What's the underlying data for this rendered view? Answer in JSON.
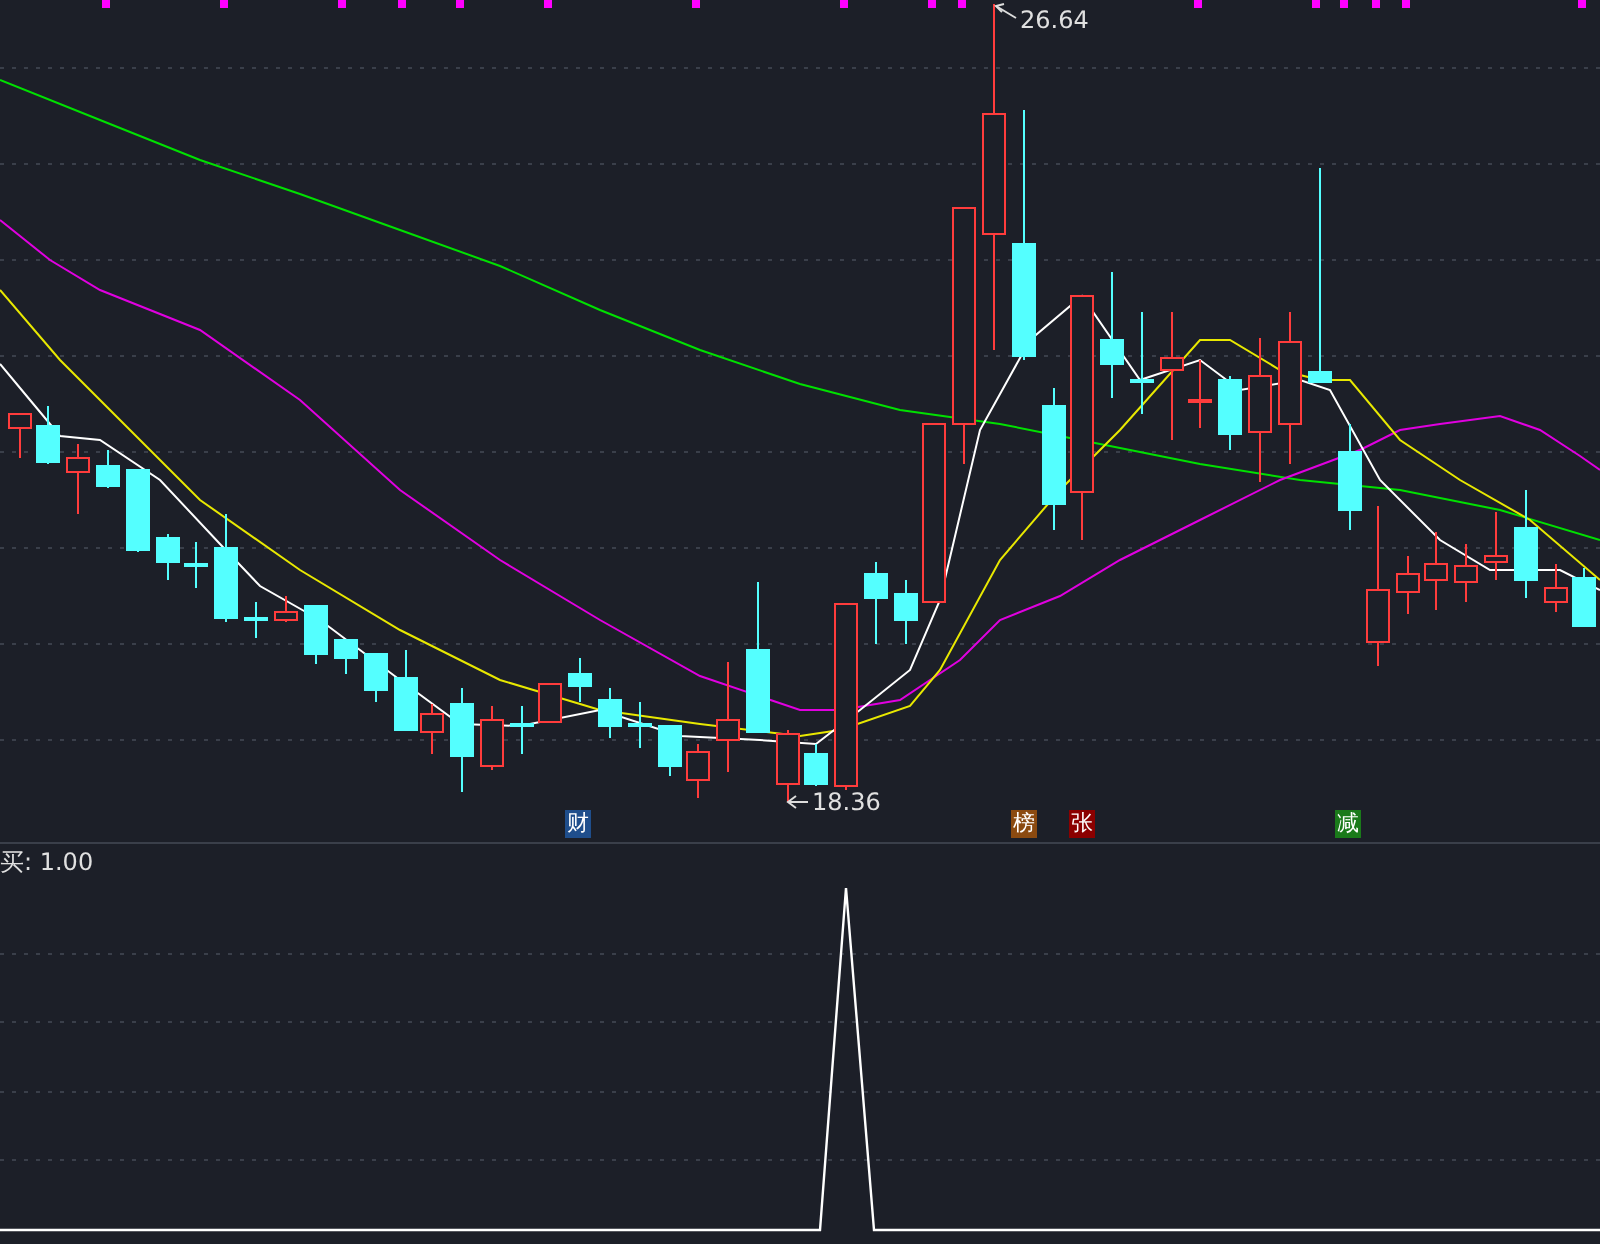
{
  "price_pane": {
    "high_label": "26.64",
    "low_label": "18.36",
    "event_tags": [
      {
        "text": "财",
        "color": "#1f4e8c"
      },
      {
        "text": "榜",
        "color": "#8b4a10"
      },
      {
        "text": "张",
        "color": "#8b0000"
      },
      {
        "text": "减",
        "color": "#1a7a1a"
      }
    ]
  },
  "indicator_pane": {
    "label": "买: 1.00"
  }
}
